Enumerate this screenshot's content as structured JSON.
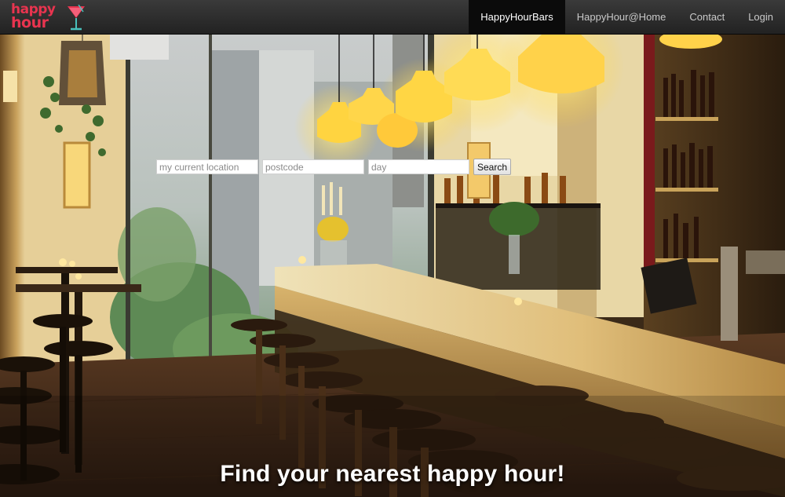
{
  "brand": {
    "line1": "happy",
    "line2": "hour",
    "color": "#e8344f",
    "logo_icon": "cocktail-glass-icon"
  },
  "nav": {
    "items": [
      {
        "label": "HappyHourBars",
        "active": true
      },
      {
        "label": "HappyHour@Home",
        "active": false
      },
      {
        "label": "Contact",
        "active": false
      },
      {
        "label": "Login",
        "active": false
      }
    ]
  },
  "search": {
    "location_placeholder": "my current location",
    "postcode_placeholder": "postcode",
    "day_placeholder": "day",
    "location_value": "",
    "postcode_value": "",
    "day_value": "",
    "button_label": "Search"
  },
  "hero": {
    "tagline": "Find your nearest happy hour!",
    "scene": "bar-interior-photo"
  }
}
